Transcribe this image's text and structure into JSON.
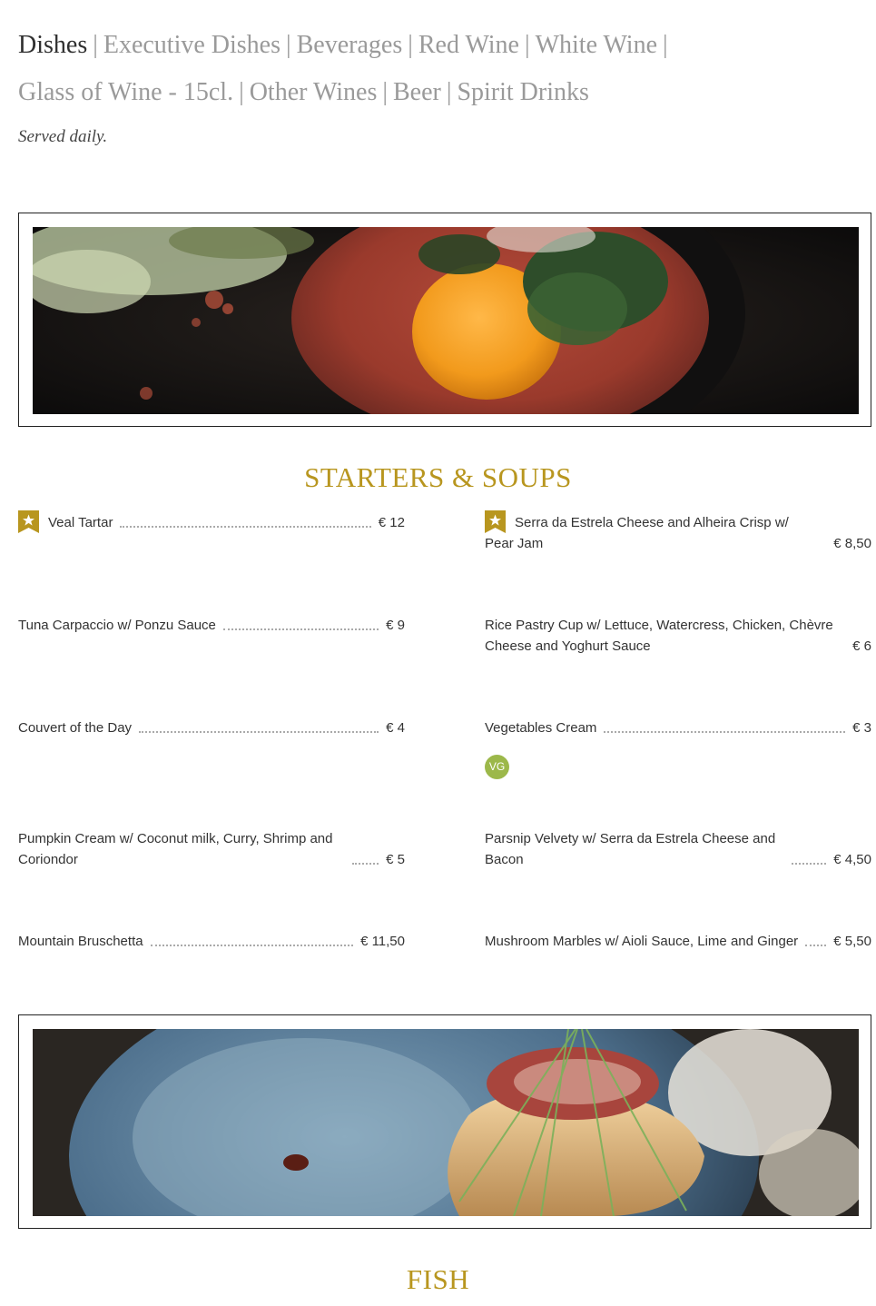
{
  "nav": {
    "row1": [
      "Dishes",
      "Executive Dishes",
      "Beverages",
      "Red Wine",
      "White Wine"
    ],
    "row2": [
      "Glass of Wine - 15cl.",
      "Other Wines",
      "Beer",
      "Spirit Drinks"
    ],
    "separator": "|",
    "active": "Dishes"
  },
  "subtitle": "Served daily.",
  "sections": [
    {
      "title": "STARTERS & SOUPS",
      "items": [
        {
          "name": "Veal Tartar",
          "price": "€ 12",
          "badge": "star-icon"
        },
        {
          "name": "Serra da Estrela Cheese and Alheira Crisp w/ Pear Jam",
          "price": "€ 8,50",
          "badge": "star-icon"
        },
        {
          "name": "Tuna Carpaccio w/ Ponzu Sauce",
          "price": "€ 9"
        },
        {
          "name": "Rice Pastry Cup w/ Lettuce, Watercress, Chicken, Chèvre Cheese and Yoghurt Sauce",
          "price": "€ 6"
        },
        {
          "name": "Couvert of the Day",
          "price": "€ 4"
        },
        {
          "name": "Vegetables Cream",
          "price": "€ 3",
          "tag": "VG"
        },
        {
          "name": "Pumpkin Cream w/ Coconut milk, Curry, Shrimp and Coriondor",
          "price": "€ 5"
        },
        {
          "name": "Parsnip Velvety w/ Serra da Estrela Cheese and Bacon",
          "price": "€ 4,50"
        },
        {
          "name": "Mountain Bruschetta",
          "price": "€ 11,50"
        },
        {
          "name": "Mushroom Marbles w/ Aioli Sauce, Lime and Ginger",
          "price": "€ 5,50"
        }
      ]
    },
    {
      "title": "FISH"
    }
  ],
  "colors": {
    "accent": "#b8961f",
    "vegan": "#9cb84a",
    "nav_inactive": "#9a9a9a",
    "nav_active": "#2f2f2f"
  }
}
